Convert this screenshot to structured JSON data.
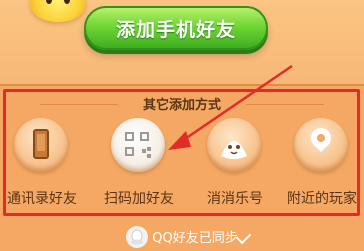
{
  "top": {
    "add_mobile_friend_label": "添加手机好友"
  },
  "panel": {
    "title": "其它添加方式",
    "options": [
      {
        "label": "通讯录好友",
        "icon": "phone-icon"
      },
      {
        "label": "扫码加好友",
        "icon": "qr-code-icon"
      },
      {
        "label": "消消乐号",
        "icon": "mascot-icon"
      },
      {
        "label": "附近的玩家",
        "icon": "location-pin-icon"
      }
    ]
  },
  "footer": {
    "sync_text": "QQ好友已同步",
    "icon": "qq-penguin-icon"
  },
  "annotation": {
    "highlight_color": "#e52a2a",
    "arrow_color": "#e52a2a"
  }
}
